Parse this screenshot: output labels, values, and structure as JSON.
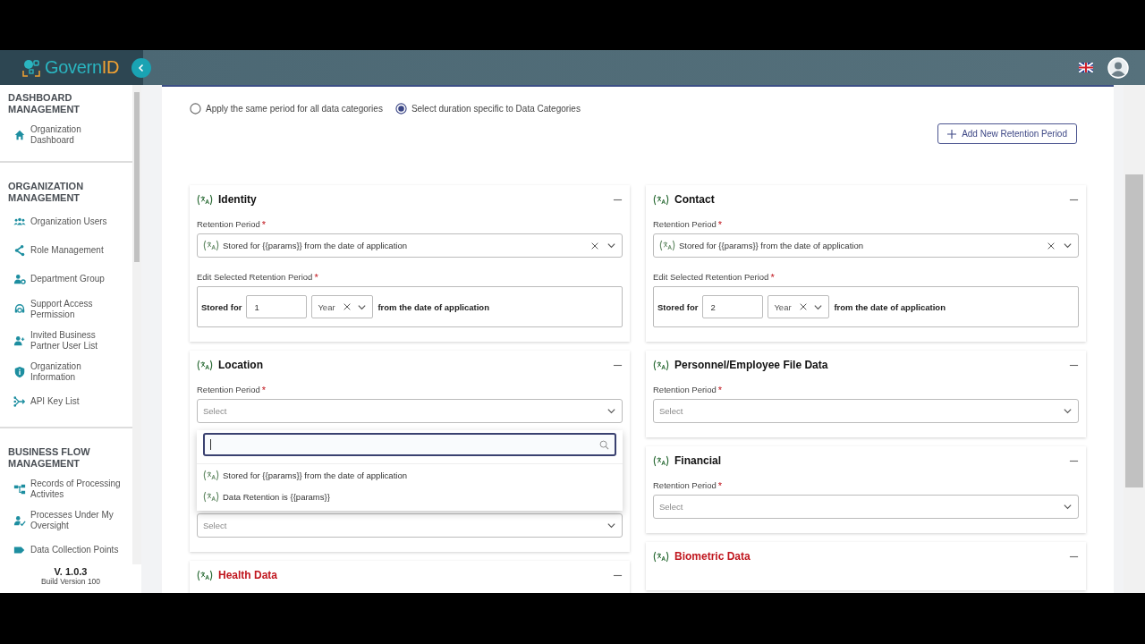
{
  "header": {
    "logo": {
      "prefix": "Govern",
      "suffix": "ID"
    }
  },
  "sidebar": {
    "sections": [
      {
        "title": "DASHBOARD MANAGEMENT",
        "items": [
          {
            "label": "Organization Dashboard",
            "kind": "home"
          }
        ]
      },
      {
        "title": "ORGANIZATION MANAGEMENT",
        "items": [
          {
            "label": "Organization Users",
            "kind": "users"
          },
          {
            "label": "Role Management",
            "kind": "share"
          },
          {
            "label": "Department Group",
            "kind": "user-gear"
          },
          {
            "label": "Support Access Permission",
            "kind": "headset"
          },
          {
            "label": "Invited Business Partner User List",
            "kind": "user-plus"
          },
          {
            "label": "Organization Information",
            "kind": "shield"
          },
          {
            "label": "API Key List",
            "kind": "fork"
          }
        ]
      },
      {
        "title": "BUSINESS FLOW MANAGEMENT",
        "items": [
          {
            "label": "Records of Processing Activites",
            "kind": "hierarchy"
          },
          {
            "label": "Processes Under My Oversight",
            "kind": "user-check"
          },
          {
            "label": "Data Collection Points",
            "kind": "tag"
          }
        ]
      }
    ],
    "version": "V. 1.0.3",
    "build": "Build Version 100"
  },
  "radios": [
    {
      "label": "Apply the same period for all data categories",
      "selected": false
    },
    {
      "label": "Select duration specific to Data Categories",
      "selected": true
    }
  ],
  "add_button": {
    "label": "Add New Retention Period"
  },
  "columns": [
    [
      {
        "title": "Identity",
        "error": false,
        "fields": [
          {
            "kind": "select",
            "label": "Retention Period",
            "required_mark": "*",
            "value": "Stored for {{params}} from the date of application"
          },
          {
            "kind": "period",
            "label": "Edit Selected Retention Period",
            "required_mark": "*",
            "prefix": "Stored for",
            "amount": "1",
            "unit": "Year",
            "suffix": "from the date of application"
          }
        ]
      },
      {
        "title": "Location",
        "error": false,
        "fields": [
          {
            "kind": "select",
            "label": "Retention Period",
            "required_mark": "*",
            "placeholder": "Select",
            "dropdown": {
              "options": [
                {
                  "label": "Stored for {{params}} from the date of application"
                },
                {
                  "label": "Data Retention is {{params}}"
                }
              ]
            }
          },
          {
            "kind": "select",
            "placeholder": "Select"
          }
        ]
      },
      {
        "title": "Health Data",
        "error": true
      }
    ],
    [
      {
        "title": "Contact",
        "error": false,
        "fields": [
          {
            "kind": "select",
            "label": "Retention Period",
            "required_mark": "*",
            "value": "Stored for {{params}} from the date of application"
          },
          {
            "kind": "period",
            "label": "Edit Selected Retention Period",
            "required_mark": "*",
            "prefix": "Stored for",
            "amount": "2",
            "unit": "Year",
            "suffix": "from the date of application"
          }
        ]
      },
      {
        "title": "Personnel/Employee File Data",
        "error": false,
        "fields": [
          {
            "kind": "select",
            "label": "Retention Period",
            "required_mark": "*",
            "placeholder": "Select"
          }
        ]
      },
      {
        "title": "Financial",
        "error": false,
        "fields": [
          {
            "kind": "select",
            "label": "Retention Period",
            "required_mark": "*",
            "placeholder": "Select"
          }
        ]
      },
      {
        "title": "Biometric Data",
        "error": true
      }
    ]
  ]
}
